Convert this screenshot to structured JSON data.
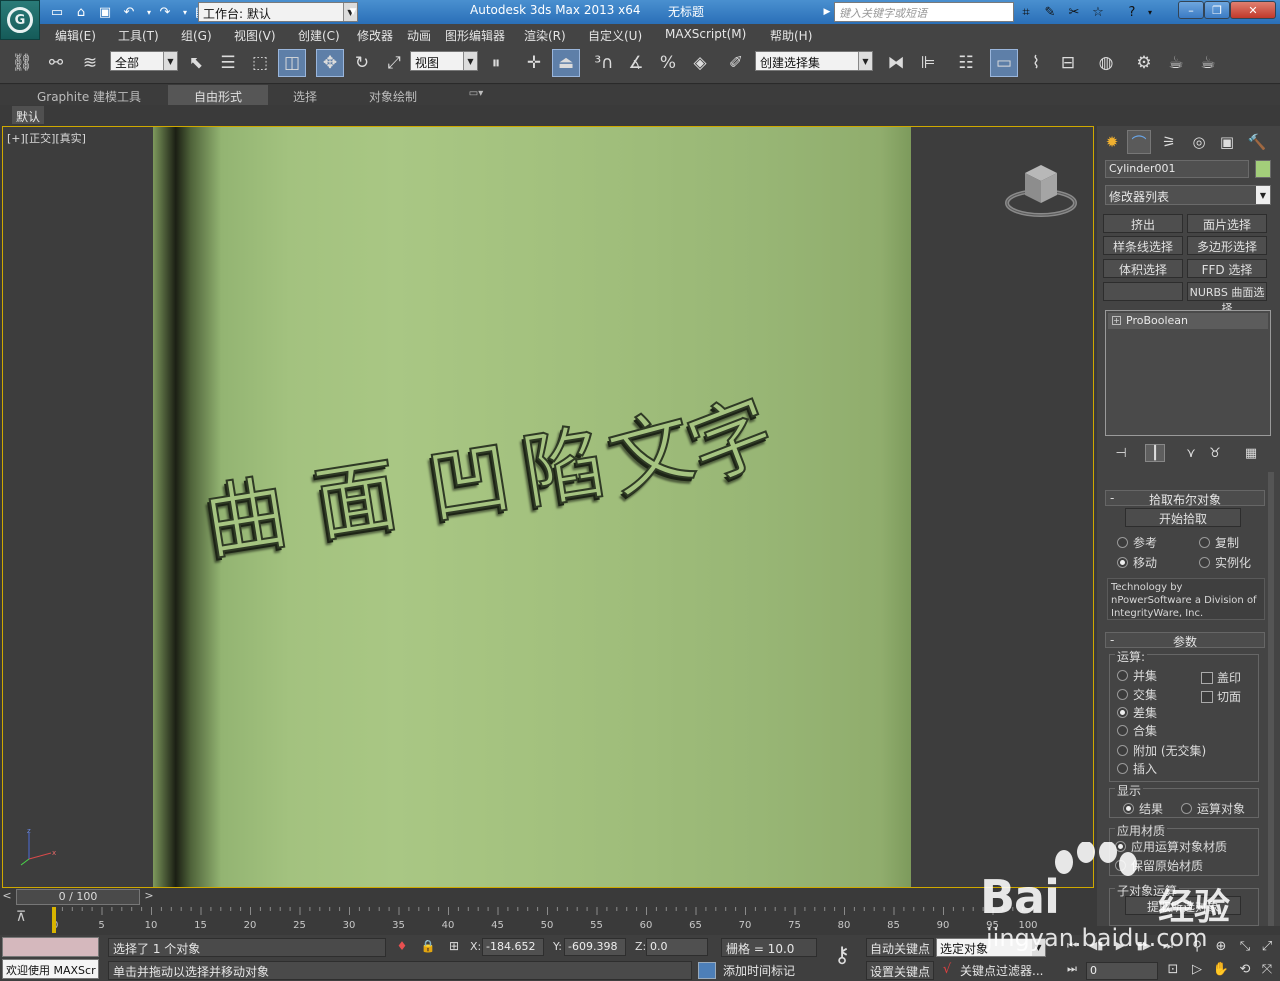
{
  "window": {
    "workspace_label": "工作台: 默认",
    "app_title": "Autodesk 3ds Max  2013 x64",
    "doc_title": "无标题",
    "search_placeholder": "键入关键字或短语"
  },
  "menu": [
    "编辑(E)",
    "工具(T)",
    "组(G)",
    "视图(V)",
    "创建(C)",
    "修改器",
    "动画",
    "图形编辑器",
    "渲染(R)",
    "自定义(U)",
    "MAXScript(M)",
    "帮助(H)"
  ],
  "toolbar": {
    "filter_value": "全部",
    "refcoord_value": "视图",
    "named_selection_placeholder": "创建选择集"
  },
  "ribbon": {
    "tabs": [
      "Graphite 建模工具",
      "自由形式",
      "选择",
      "对象绘制"
    ],
    "active_tab": "自由形式",
    "sub_label": "默认"
  },
  "viewport": {
    "label": "[+][正交][真实]",
    "engraved_text": [
      "曲",
      "面",
      "凹",
      "陷",
      "文",
      "字"
    ],
    "cylinder_color": "#a6c481"
  },
  "command_panel": {
    "object_name": "Cylinder001",
    "object_color": "#a3ce7a",
    "modifier_list": "修改器列表",
    "modifier_buttons": [
      "挤出",
      "面片选择",
      "样条线选择",
      "多边形选择",
      "体积选择",
      "FFD 选择",
      "",
      "NURBS 曲面选择"
    ],
    "stack_item": "ProBoolean",
    "pick_rollout": {
      "title": "拾取布尔对象",
      "start_pick": "开始拾取",
      "options": [
        "参考",
        "复制",
        "移动",
        "实例化"
      ],
      "selected": "移动",
      "tech_note": "Technology by nPowerSoftware a Division of IntegrityWare, Inc."
    },
    "params_rollout": {
      "title": "参数",
      "operation_label": "运算:",
      "operations": [
        "并集",
        "交集",
        "差集",
        "合集",
        "附加 (无交集)",
        "插入"
      ],
      "selected_operation": "差集",
      "checks": [
        "盖印",
        "切面"
      ],
      "display_label": "显示",
      "display_options": [
        "结果",
        "运算对象"
      ],
      "display_selected": "结果",
      "material_label": "应用材质",
      "material_options": [
        "应用运算对象材质",
        "保留原始材质"
      ],
      "material_selected": "应用运算对象材质",
      "sub_label": "子对象运算",
      "extract_button": "提取所选对象"
    }
  },
  "timeline": {
    "frame_display": "0 / 100",
    "ticks": [
      "0",
      "5",
      "10",
      "15",
      "20",
      "25",
      "30",
      "35",
      "40",
      "45",
      "50",
      "55",
      "60",
      "65",
      "70",
      "75",
      "80",
      "85",
      "90",
      "95",
      "100"
    ]
  },
  "status": {
    "welcome": "欢迎使用 MAXScr",
    "selection_count": "选择了 1 个对象",
    "prompt": "单击并拖动以选择并移动对象",
    "x_label": "X:",
    "x_value": "-184.652",
    "y_label": "Y:",
    "y_value": "-609.398",
    "z_label": "Z:",
    "z_value": "0.0",
    "grid": "栅格 = 10.0",
    "add_time_tag": "添加时间标记",
    "auto_key": "自动关键点",
    "set_key": "设置关键点",
    "selected_object": "选定对象",
    "key_filters": "关键点过滤器...",
    "frame_value": "0"
  },
  "watermark": {
    "brand": "Bai",
    "brand_tail": "经验",
    "url": "jingyan.baidu.com"
  }
}
